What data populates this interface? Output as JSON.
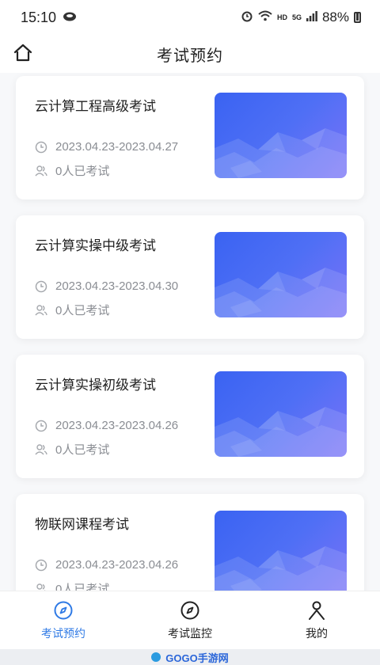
{
  "status_bar": {
    "time": "15:10",
    "network_label": "HD",
    "signal_label": "5G",
    "battery_percent": "88%"
  },
  "header": {
    "title": "考试预约"
  },
  "exams": [
    {
      "name": "云计算工程高级考试",
      "date": "2023.04.23-2023.04.27",
      "count": "0人已考试"
    },
    {
      "name": "云计算实操中级考试",
      "date": "2023.04.23-2023.04.30",
      "count": "0人已考试"
    },
    {
      "name": "云计算实操初级考试",
      "date": "2023.04.23-2023.04.26",
      "count": "0人已考试"
    },
    {
      "name": "物联网课程考试",
      "date": "2023.04.23-2023.04.26",
      "count": "0人已考试"
    }
  ],
  "tabbar": {
    "tabs": [
      {
        "label": "考试预约",
        "active": true
      },
      {
        "label": "考试监控",
        "active": false
      },
      {
        "label": "我的",
        "active": false
      }
    ]
  },
  "watermark": {
    "text": "GOGO手游网"
  },
  "colors": {
    "accent": "#2f7ae5",
    "thumb_start": "#3a63f2",
    "thumb_end": "#7a72f7"
  }
}
